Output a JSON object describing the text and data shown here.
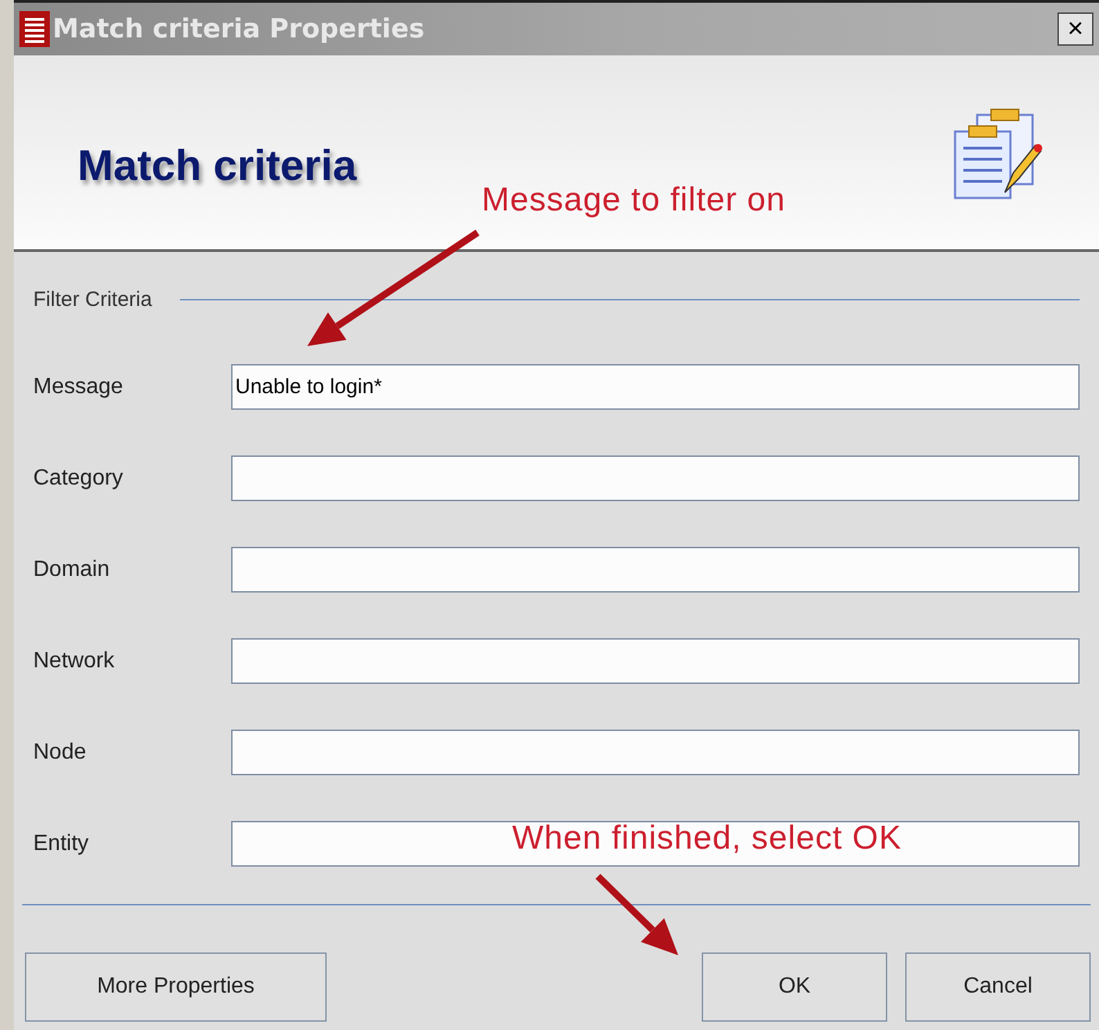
{
  "window": {
    "title": "Match criteria Properties",
    "close": "×"
  },
  "header": {
    "title": "Match criteria"
  },
  "section": {
    "title": "Filter Criteria"
  },
  "fields": [
    {
      "label": "Message",
      "value": "Unable to login*"
    },
    {
      "label": "Category"
    },
    {
      "label": "Domain"
    },
    {
      "label": "Network"
    },
    {
      "label": "Node"
    },
    {
      "label": "Entity"
    }
  ],
  "buttons": [
    {
      "label": "More Properties",
      "kind": "left"
    },
    {
      "label": "OK",
      "kind": "right"
    },
    {
      "label": "Cancel",
      "kind": "right"
    }
  ],
  "annotations": [
    {
      "text": "Message to filter on"
    },
    {
      "text": "When finished, select OK"
    }
  ]
}
